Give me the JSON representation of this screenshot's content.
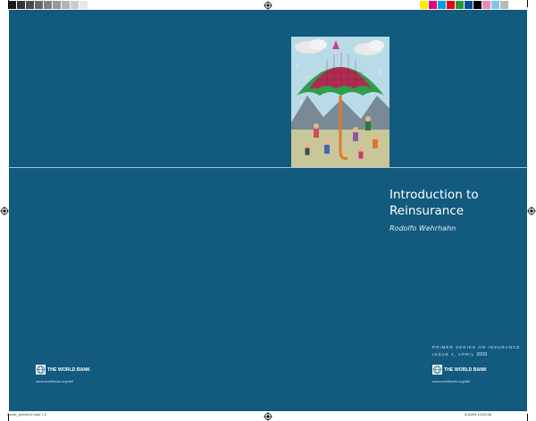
{
  "colors": {
    "cover_background": "#125a7e",
    "title_text": "#ffffff",
    "grayscale_bar": [
      "#1a1a1a",
      "#333333",
      "#4d4d4d",
      "#666666",
      "#808080",
      "#999999",
      "#b3b3b3",
      "#cccccc",
      "#e6e6e6",
      "#ffffff"
    ],
    "process_bar": [
      "#ffed00",
      "#e6007e",
      "#00a0e3",
      "#e30613",
      "#1d9a3b",
      "#004f9f",
      "#000000",
      "#e98ab6",
      "#7dc7ec",
      "#b9b9b9"
    ]
  },
  "cover": {
    "title": "Introduction to\nReinsurance",
    "author": "Rodolfo Wehrhahn",
    "series_line": "PRIMER SERIES ON INSURANCE",
    "issue_prefix": "ISSUE 2, APRIL ",
    "issue_year": "2009",
    "illustration_icon": "umbrella-illustration"
  },
  "back_cover": {
    "logo_text": "THE WORLD BANK",
    "url": "www.worldbank.org/nbfi"
  },
  "front_cover": {
    "logo_text": "THE WORLD BANK",
    "url": "www.worldbank.org/nbfi"
  },
  "print_marks": {
    "slug_left": "Cover_primer02.indd   1-2",
    "slug_right": "5/15/09   10:53:08"
  }
}
